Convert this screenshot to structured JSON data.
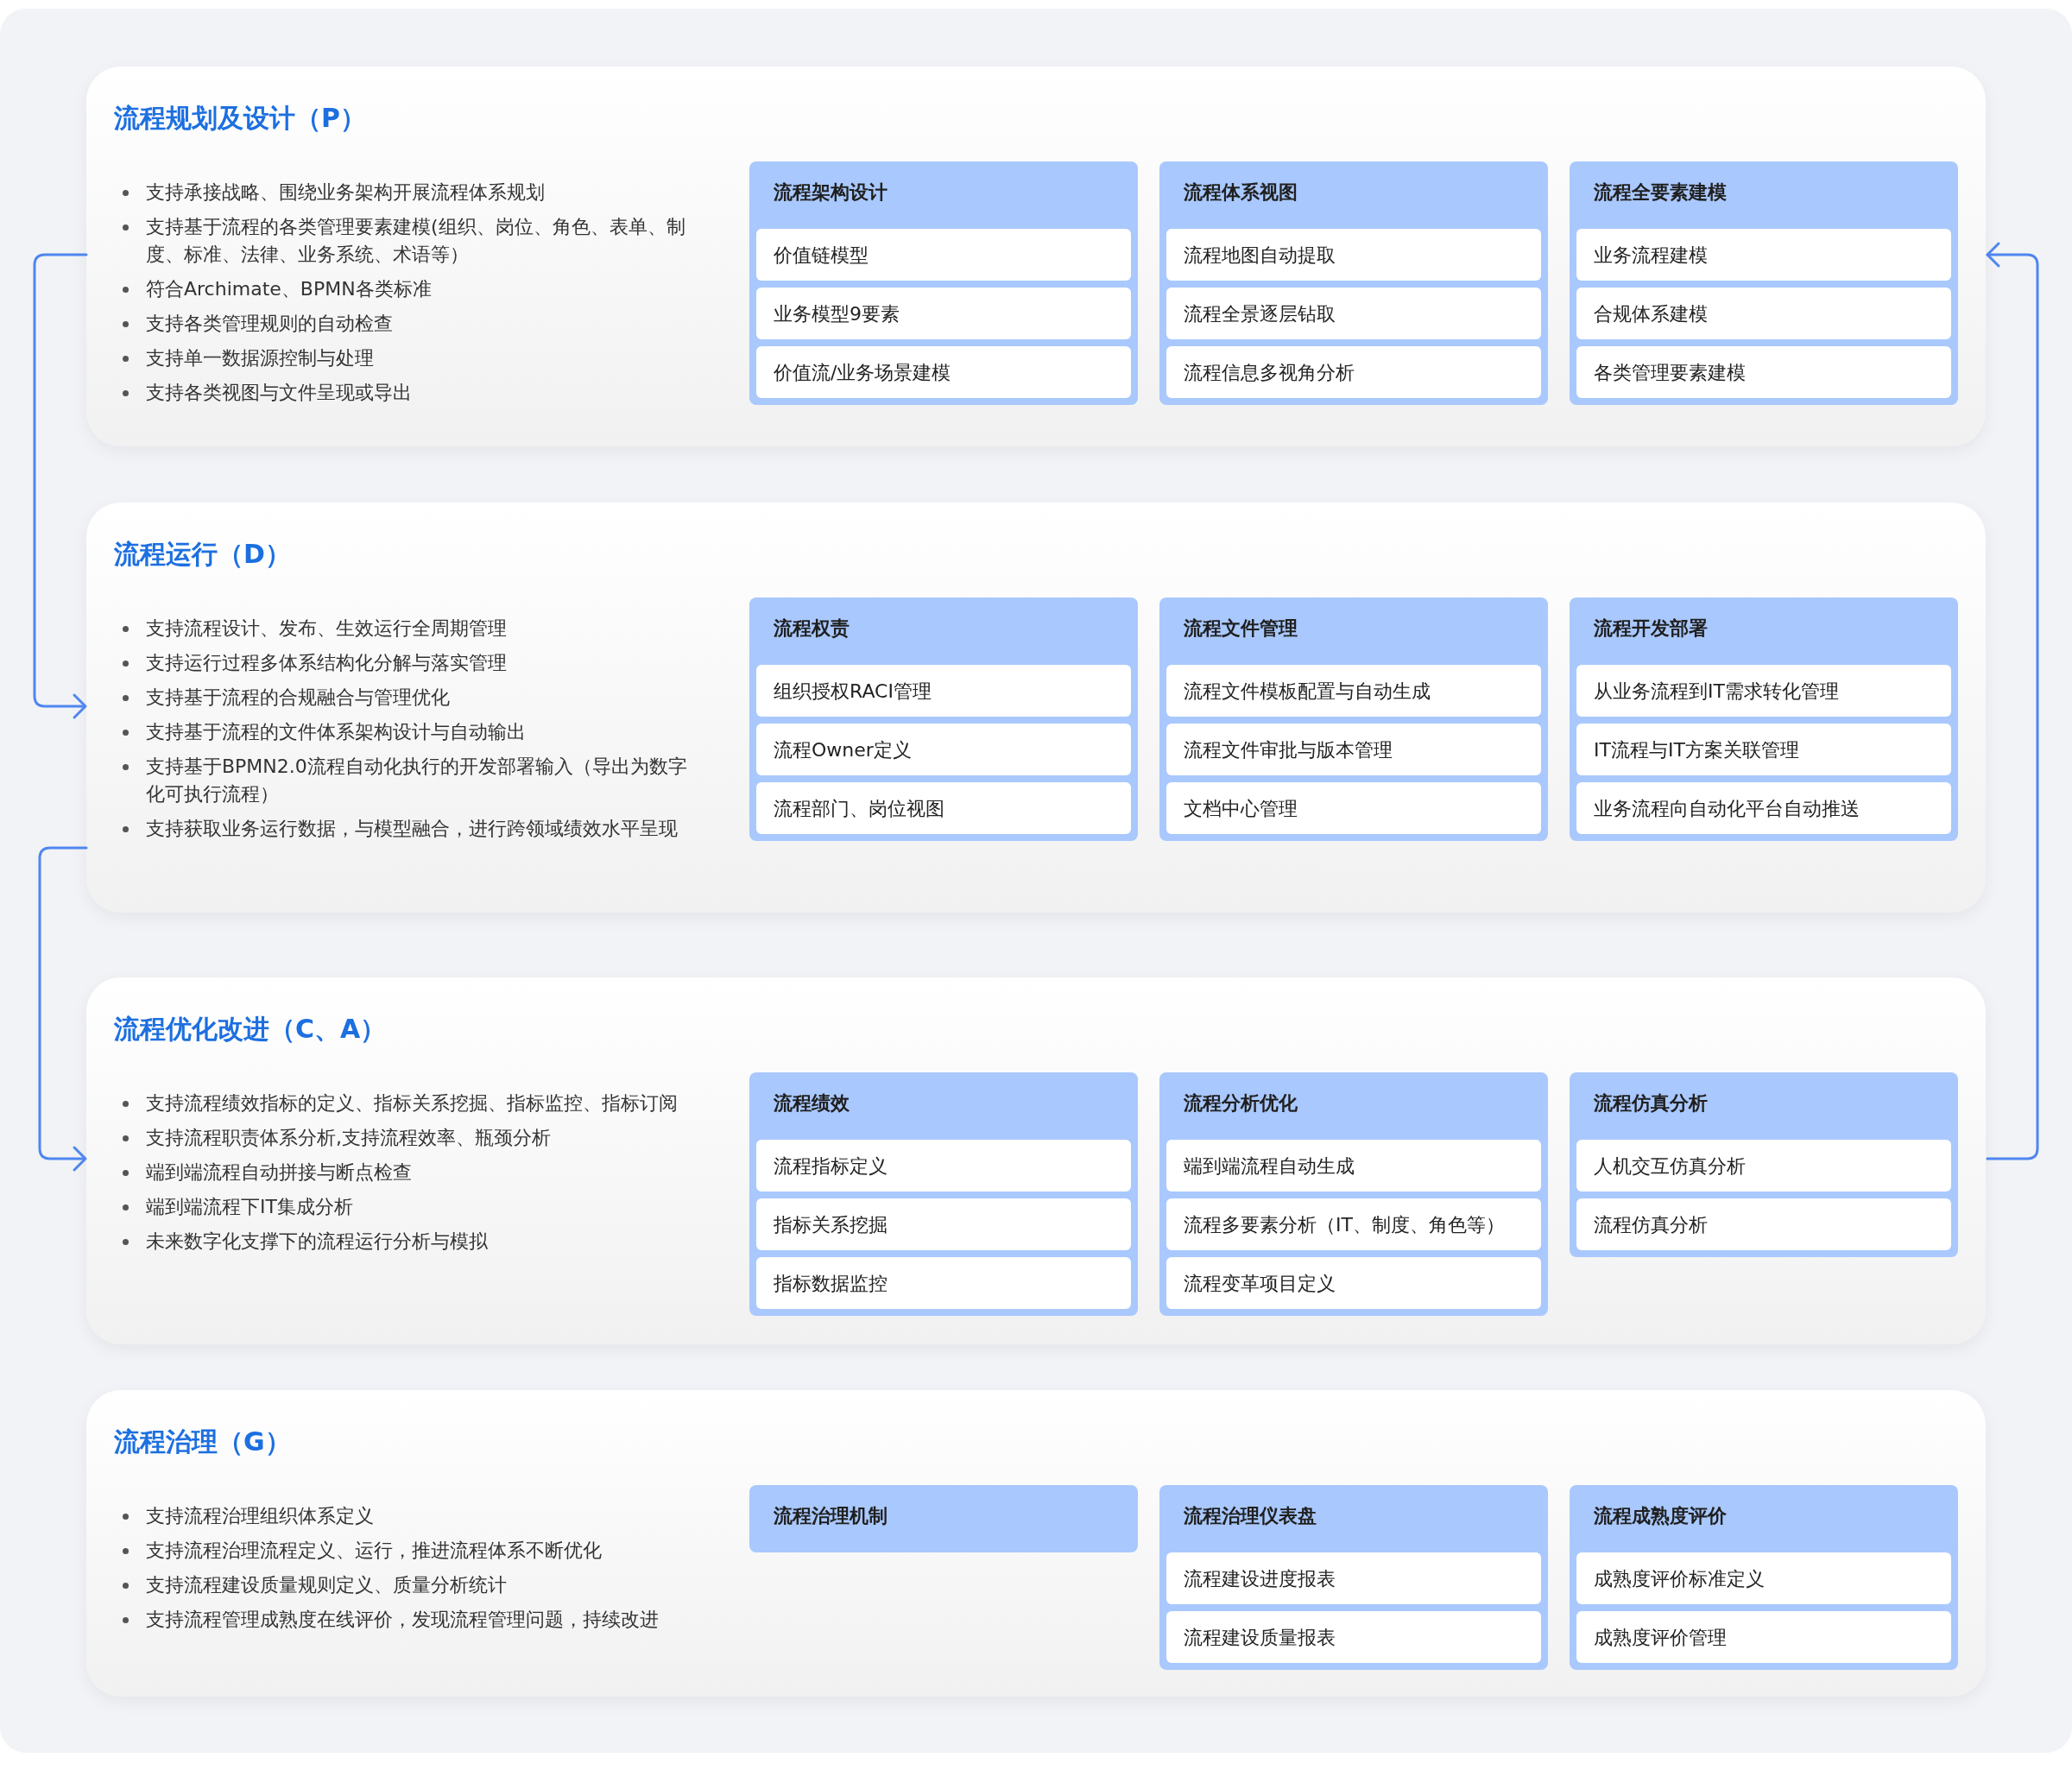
{
  "sections": [
    {
      "title": "流程规划及设计（P）",
      "bullets": [
        "支持承接战略、围绕业务架构开展流程体系规划",
        "支持基于流程的各类管理要素建模(组织、岗位、角色、表单、制度、标准、法律、业务系统、术语等）",
        "符合Archimate、BPMN各类标准",
        "支持各类管理规则的自动检查",
        "支持单一数据源控制与处理",
        "支持各类视图与文件呈现或导出"
      ],
      "groups": [
        {
          "title": "流程架构设计",
          "items": [
            "价值链模型",
            "业务模型9要素",
            "价值流/业务场景建模"
          ]
        },
        {
          "title": "流程体系视图",
          "items": [
            "流程地图自动提取",
            "流程全景逐层钻取",
            "流程信息多视角分析"
          ]
        },
        {
          "title": "流程全要素建模",
          "items": [
            "业务流程建模",
            "合规体系建模",
            "各类管理要素建模"
          ]
        }
      ]
    },
    {
      "title": "流程运行（D）",
      "bullets": [
        "支持流程设计、发布、生效运行全周期管理",
        "支持运行过程多体系结构化分解与落实管理",
        "支持基于流程的合规融合与管理优化",
        "支持基于流程的文件体系架构设计与自动输出",
        "支持基于BPMN2.0流程自动化执行的开发部署输入（导出为数字化可执行流程）",
        "支持获取业务运行数据，与模型融合，进行跨领域绩效水平呈现"
      ],
      "groups": [
        {
          "title": "流程权责",
          "items": [
            "组织授权RACI管理",
            "流程Owner定义",
            "流程部门、岗位视图"
          ]
        },
        {
          "title": "流程文件管理",
          "items": [
            "流程文件模板配置与自动生成",
            "流程文件审批与版本管理",
            "文档中心管理"
          ]
        },
        {
          "title": "流程开发部署",
          "items": [
            "从业务流程到IT需求转化管理",
            "IT流程与IT方案关联管理",
            "业务流程向自动化平台自动推送"
          ]
        }
      ]
    },
    {
      "title": "流程优化改进（C、A）",
      "bullets": [
        "支持流程绩效指标的定义、指标关系挖掘、指标监控、指标订阅",
        "支持流程职责体系分析,支持流程效率、瓶颈分析",
        "端到端流程自动拼接与断点检查",
        "端到端流程下IT集成分析",
        "未来数字化支撑下的流程运行分析与模拟"
      ],
      "groups": [
        {
          "title": "流程绩效",
          "items": [
            "流程指标定义",
            "指标关系挖掘",
            "指标数据监控"
          ]
        },
        {
          "title": "流程分析优化",
          "items": [
            "端到端流程自动生成",
            "流程多要素分析（IT、制度、角色等）",
            "流程变革项目定义"
          ]
        },
        {
          "title": "流程仿真分析",
          "items": [
            "人机交互仿真分析",
            "流程仿真分析"
          ]
        }
      ]
    },
    {
      "title": "流程治理（G）",
      "bullets": [
        "支持流程治理组织体系定义",
        "支持流程治理流程定义、运行，推进流程体系不断优化",
        "支持流程建设质量规则定义、质量分析统计",
        "支持流程管理成熟度在线评价，发现流程管理问题，持续改进"
      ],
      "groups": [
        {
          "title": "流程治理机制"
        },
        {
          "title": "流程治理仪表盘",
          "items": [
            "流程建设进度报表",
            "流程建设质量报表"
          ]
        },
        {
          "title": "流程成熟度评价",
          "items": [
            "成熟度评价标准定义",
            "成熟度评价管理"
          ]
        }
      ]
    }
  ]
}
